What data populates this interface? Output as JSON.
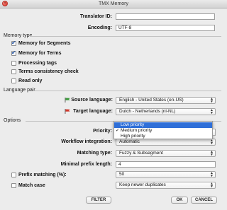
{
  "window": {
    "title": "TMX Memory",
    "close_glyph": "×"
  },
  "translator_id": {
    "label": "Translator ID:",
    "value": ""
  },
  "encoding": {
    "label": "Encoding:",
    "value": "UTF-8"
  },
  "memory_type": {
    "title": "Memory type",
    "options": [
      {
        "label": "Memory for Segments",
        "checked": true
      },
      {
        "label": "Memory for Terms",
        "checked": true
      },
      {
        "label": "Processing tags",
        "checked": false
      },
      {
        "label": "Terms consistency check",
        "checked": false
      },
      {
        "label": "Read only",
        "checked": false
      }
    ]
  },
  "language_pair": {
    "title": "Language pair",
    "source": {
      "label": "Source language:",
      "value": "English - United States (en-US)",
      "icon": "flag-green-icon",
      "color": "#3b9a3b"
    },
    "target": {
      "label": "Target language:",
      "value": "Dutch - Netherlands (nl-NL)",
      "icon": "flag-red-icon",
      "color": "#d2392c"
    }
  },
  "options": {
    "title": "Options",
    "priority": {
      "label": "Priority:",
      "value": "Medium priority"
    },
    "workflow_integration": {
      "label": "Workflow integration:",
      "value": "Automatic"
    },
    "matching_type": {
      "label": "Matching type:",
      "value": "Fuzzy & Subsegment"
    },
    "minimal_prefix_length": {
      "label": "Minimal prefix length:",
      "value": "4"
    },
    "prefix_matching": {
      "label": "Prefix matching (%):",
      "value": "50",
      "checked": false
    },
    "match_case": {
      "label": "Match case",
      "value": "Keep newer duplicates",
      "checked": false
    }
  },
  "priority_dropdown": {
    "items": [
      {
        "label": "Low priority",
        "highlighted": true,
        "selected": false
      },
      {
        "label": "Medium priority",
        "highlighted": false,
        "selected": true
      },
      {
        "label": "High priority",
        "highlighted": false,
        "selected": false
      }
    ],
    "check_glyph": "✓"
  },
  "buttons": {
    "filter": "FILTER",
    "ok": "OK",
    "cancel": "CANCEL"
  },
  "colors": {
    "highlight": "#2f6fd8"
  }
}
